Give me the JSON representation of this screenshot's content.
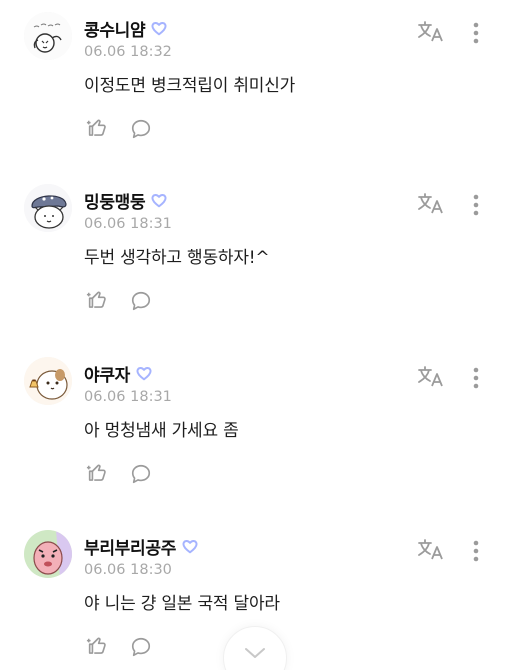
{
  "colors": {
    "username": "#111111",
    "timestamp": "#a8a8a8",
    "icon": "#9b9b9b",
    "badge_left": "#8fa6ff",
    "badge_right": "#c5a6ff"
  },
  "comments": [
    {
      "username": "콩수니얌",
      "timestamp": "06.06 18:32",
      "text": "이정도면 병크적립이 취미신가",
      "avatar_icon": "doodle-face-avatar"
    },
    {
      "username": "밍둥맹둥",
      "timestamp": "06.06 18:31",
      "text": "두번 생각하고 행동하자!^",
      "avatar_icon": "hooded-cat-avatar"
    },
    {
      "username": "야쿠자",
      "timestamp": "06.06 18:31",
      "text": "아 멍청냄새 가세요 좀",
      "avatar_icon": "puppy-with-pudding-avatar"
    },
    {
      "username": "부리부리공주",
      "timestamp": "06.06 18:30",
      "text": "야 니는 걍 일본 국적 달아라",
      "avatar_icon": "cartoon-character-avatar"
    }
  ],
  "icons": {
    "translate": "translate-icon",
    "more": "more-vertical-icon",
    "react": "reaction-add-icon",
    "reply": "reply-bubble-icon",
    "scroll": "chevron-down-icon"
  }
}
